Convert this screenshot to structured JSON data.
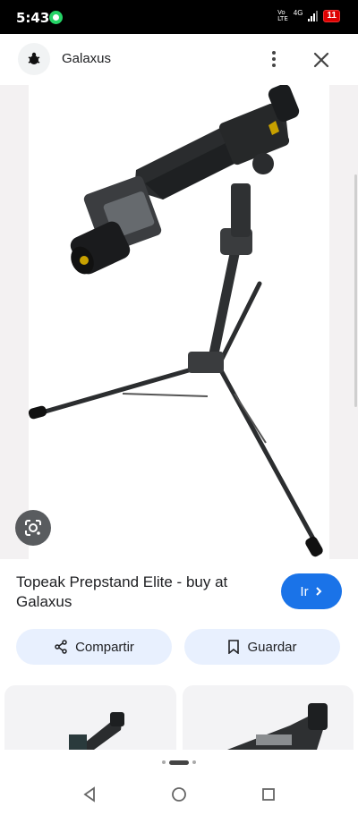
{
  "status_bar": {
    "time": "5:43",
    "volte_top": "Vo",
    "volte_bottom": "LTE",
    "network": "4G",
    "battery": "11"
  },
  "header": {
    "site_name": "Galaxus",
    "logo_icon": "galaxus-logo-icon",
    "menu_icon": "more-vert-icon",
    "close_icon": "close-icon"
  },
  "result": {
    "title": "Topeak Prepstand Elite - buy at Galaxus",
    "go_label": "Ir",
    "share_label": "Compartir",
    "save_label": "Guardar"
  },
  "colors": {
    "accent": "#1a73e8",
    "chip_bg": "#e8f0fe",
    "battery_low": "#dd0000"
  },
  "pager": {
    "dots": 4,
    "active_index": 1
  }
}
